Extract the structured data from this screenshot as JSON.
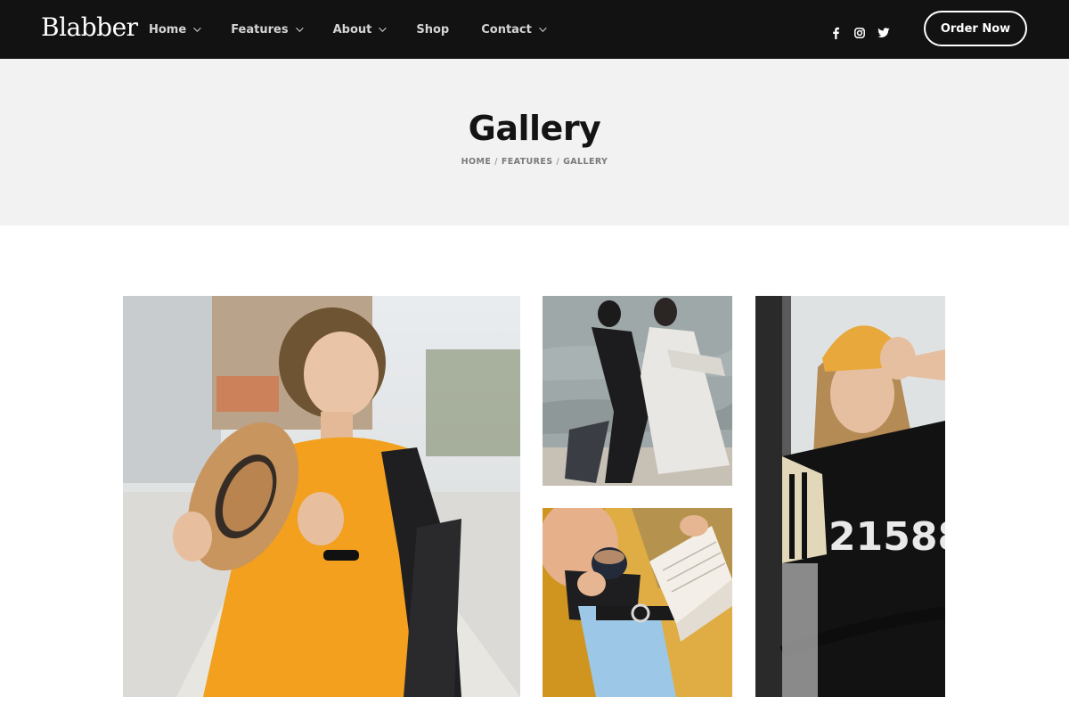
{
  "brand": {
    "logo_text": "Blabber"
  },
  "nav": {
    "items": [
      {
        "label": "Home",
        "has_dropdown": true
      },
      {
        "label": "Features",
        "has_dropdown": true
      },
      {
        "label": "About",
        "has_dropdown": true
      },
      {
        "label": "Shop",
        "has_dropdown": false
      },
      {
        "label": "Contact",
        "has_dropdown": true
      }
    ]
  },
  "social": [
    "facebook-icon",
    "instagram-icon",
    "twitter-icon"
  ],
  "header": {
    "cta_label": "Order Now"
  },
  "title_section": {
    "title": "Gallery",
    "breadcrumb": [
      "HOME",
      "FEATURES",
      "GALLERY"
    ]
  },
  "colors": {
    "header_bg": "#121212",
    "title_band_bg": "#f2f2f2",
    "accent_orange": "#f0a020",
    "text_dark": "#141414"
  }
}
